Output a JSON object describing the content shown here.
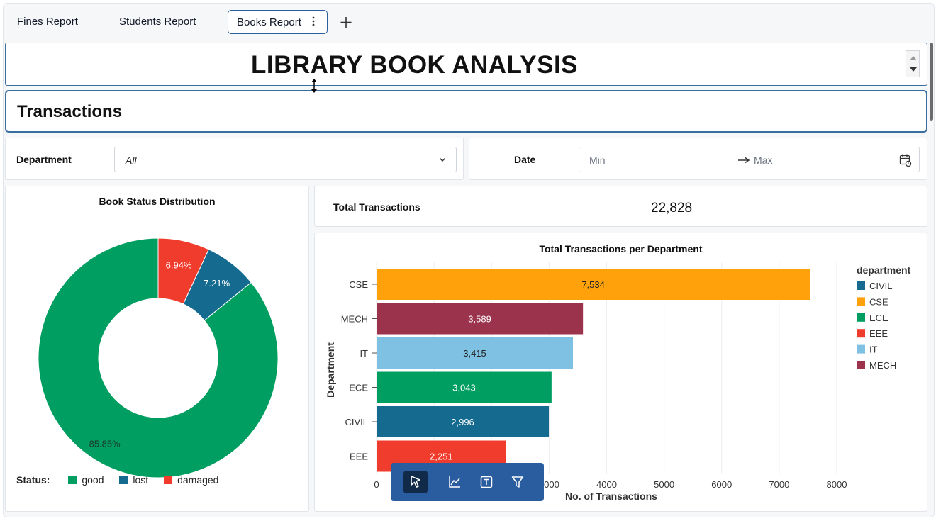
{
  "tabs": [
    {
      "label": "Fines Report"
    },
    {
      "label": "Students Report"
    },
    {
      "label": "Books Report",
      "active": true
    }
  ],
  "header": {
    "title": "LIBRARY BOOK ANALYSIS"
  },
  "section": {
    "title": "Transactions"
  },
  "filters": {
    "department_label": "Department",
    "department_value": "All",
    "date_label": "Date",
    "date_min": "Min",
    "date_max": "Max"
  },
  "kpi": {
    "label": "Total Transactions",
    "value": "22,828"
  },
  "colors": {
    "good": "#009e60",
    "lost": "#156b8f",
    "damaged": "#f03c2d",
    "CIVIL": "#156b8f",
    "CSE": "#fea10b",
    "ECE": "#009e60",
    "EEE": "#f03c2d",
    "IT": "#7ec1e3",
    "MECH": "#9b334d",
    "toolbar": "#2a5d9f",
    "accent_border": "#3a6e9f"
  },
  "chart_data": [
    {
      "type": "pie",
      "title": "Book Status Distribution",
      "donut": true,
      "legend_title": "Status:",
      "legend_position": "bottom-left",
      "slices": [
        {
          "name": "good",
          "label": "85.85%",
          "value": 85.85
        },
        {
          "name": "lost",
          "label": "7.21%",
          "value": 7.21
        },
        {
          "name": "damaged",
          "label": "6.94%",
          "value": 6.94
        }
      ]
    },
    {
      "type": "bar",
      "orientation": "horizontal",
      "title": "Total Transactions per Department",
      "xlabel": "No. of Transactions",
      "ylabel": "Department",
      "xlim": [
        0,
        8000
      ],
      "xticks": [
        "0",
        "1000",
        "2000",
        "3000",
        "4000",
        "5000",
        "6000",
        "7000",
        "8000"
      ],
      "grid": true,
      "legend_title": "department",
      "legend_position": "top-right",
      "legend_items": [
        "CIVIL",
        "CSE",
        "ECE",
        "EEE",
        "IT",
        "MECH"
      ],
      "categories": [
        "CSE",
        "MECH",
        "IT",
        "ECE",
        "CIVIL",
        "EEE"
      ],
      "values": [
        7534,
        3589,
        3415,
        3043,
        2996,
        2251
      ],
      "labels": [
        "7,534",
        "3,589",
        "3,415",
        "3,043",
        "2,996",
        "2,251"
      ]
    }
  ],
  "toolbar": {
    "buttons": [
      {
        "icon": "pointer-icon",
        "active": true
      },
      {
        "icon": "line-chart-icon"
      },
      {
        "icon": "text-box-icon"
      },
      {
        "icon": "filter-icon"
      }
    ]
  }
}
